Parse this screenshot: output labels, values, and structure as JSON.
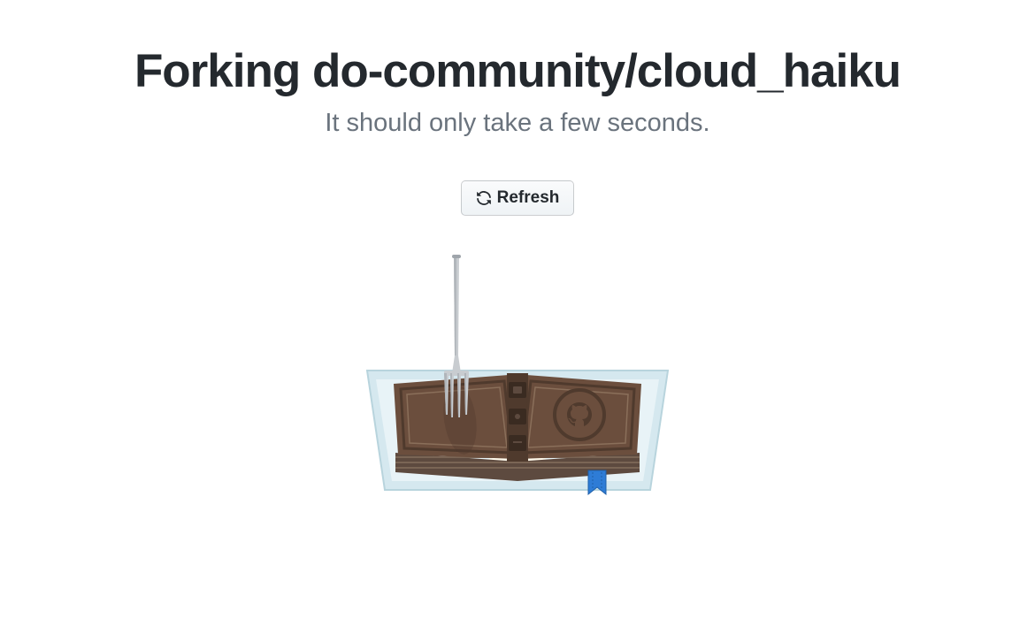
{
  "heading": "Forking do-community/cloud_haiku",
  "subheading": "It should only take a few seconds.",
  "refresh_button_label": "Refresh"
}
